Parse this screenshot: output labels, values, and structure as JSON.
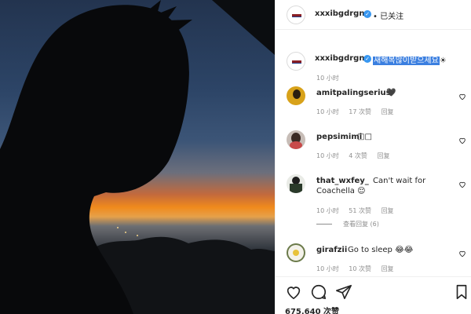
{
  "post": {
    "author": "xxxibgdrgn",
    "follow_label": "• 已关注",
    "caption_highlight": "새해복많이받으세요",
    "caption_suffix": "☀",
    "caption_time": "10 小时",
    "likes": "675,640 次赞"
  },
  "comments": [
    {
      "user": "amitpalingserius",
      "text": "🖤",
      "time": "10 小时",
      "likes": "17 次赞",
      "reply": "回复"
    },
    {
      "user": "pepsimimi",
      "text": "□□",
      "time": "10 小时",
      "likes": "4 次赞",
      "reply": "回复"
    },
    {
      "user": "that_wxfey_",
      "text_line1": "Can't wait for",
      "text_line2": "Coachella 😌",
      "time": "10 小时",
      "likes": "51 次赞",
      "reply": "回复",
      "view_replies": "查看回复 (6)"
    },
    {
      "user": "girafzii",
      "text": "Go to sleep 😂😂",
      "time": "10 小时",
      "likes": "10 次赞",
      "reply": "回复"
    }
  ],
  "icons": {
    "like": "heart-icon",
    "comment": "comment-icon",
    "share": "share-icon",
    "save": "bookmark-icon",
    "verified": "verified-badge-icon"
  }
}
